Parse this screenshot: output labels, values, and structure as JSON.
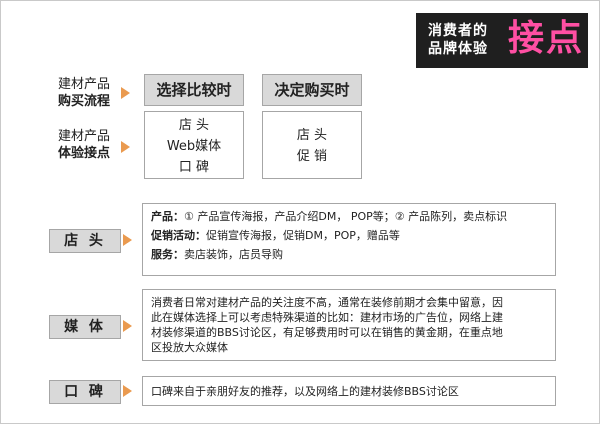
{
  "title": {
    "line1": "消费者的",
    "line2": "品牌体验",
    "big": "接点"
  },
  "rows": {
    "process_label": {
      "line1": "建材产品",
      "line2": "购买流程"
    },
    "touch_label": {
      "line1": "建材产品",
      "line2": "体验接点"
    }
  },
  "stages": [
    {
      "header": "选择比较时",
      "items": [
        "店 头",
        "Web媒体",
        "口 碑"
      ]
    },
    {
      "header": "决定购买时",
      "items": [
        "店 头",
        "促 销"
      ]
    }
  ],
  "categories": [
    {
      "label": "店 头",
      "lines": [
        {
          "key": "产品：",
          "text": "① 产品宣传海报，产品介绍DM， POP等；② 产品陈列，卖点标识"
        },
        {
          "key": "促销活动：",
          "text": "促销宣传海报，促销DM，POP，赠品等"
        },
        {
          "key": "服务：",
          "text": "卖店装饰，店员导购"
        }
      ]
    },
    {
      "label": "媒 体",
      "lines": [
        {
          "key": "",
          "text": "消费者日常对建材产品的关注度不高，通常在装修前期才会集中留意，因"
        },
        {
          "key": "",
          "text": "此在媒体选择上可以考虑特殊渠道的比如：建材市场的广告位，网络上建"
        },
        {
          "key": "",
          "text": "材装修渠道的BBS讨论区，有足够费用时可以在销售的黄金期，在重点地"
        },
        {
          "key": "",
          "text": "区投放大众媒体"
        }
      ]
    },
    {
      "label": "口 碑",
      "lines": [
        {
          "key": "",
          "text": "口碑来自于亲朋好友的推荐，以及网络上的建材装修BBS讨论区"
        }
      ]
    }
  ],
  "colors": {
    "accent_pink": "#ff4fa3",
    "arrow_orange": "#ea9a4f",
    "header_gray": "#d9d9d9",
    "title_bg": "#1f1f1f"
  }
}
